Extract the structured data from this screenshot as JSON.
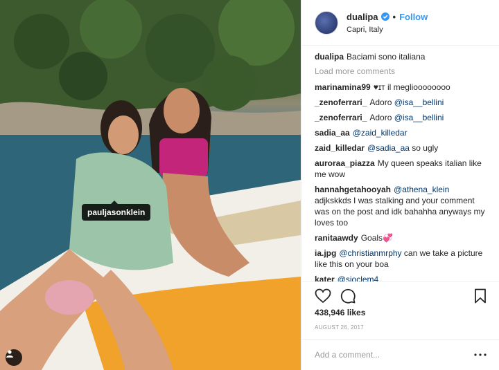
{
  "post": {
    "tag_label": "pauljasonklein",
    "icons": {
      "user_tag": "person-icon"
    }
  },
  "header": {
    "username": "dualipa",
    "verified_icon": "verified-badge-icon",
    "separator": "•",
    "follow_label": "Follow",
    "location": "Capri, Italy"
  },
  "caption": {
    "username": "dualipa",
    "text": "Baciami sono italiana"
  },
  "load_more": "Load more comments",
  "comments": [
    {
      "user": "marinamina99",
      "text": "♥ɪт il meglioooooooo"
    },
    {
      "user": "_zenoferrari_",
      "pre": "Adoro ",
      "mention": "@isa__bellini"
    },
    {
      "user": "_zenoferrari_",
      "pre": "Adoro ",
      "mention": "@isa__bellini"
    },
    {
      "user": "sadia_aa",
      "pre": "",
      "mention": "@zaid_killedar"
    },
    {
      "user": "zaid_killedar",
      "pre": "",
      "mention": "@sadia_aa",
      "post": " so ugly"
    },
    {
      "user": "auroraa_piazza",
      "text": "My queen speaks italian like me wow"
    },
    {
      "user": "hannahgetahooyah",
      "pre": "",
      "mention": "@athena_klein",
      "post": " adjkskkds I was stalking and your comment was on the post and idk bahahha anyways my loves too"
    },
    {
      "user": "ranitaawdy",
      "text": "Goals💞"
    },
    {
      "user": "ia.jpg",
      "pre": "",
      "mention": "@christianmrphy",
      "post": " can we take a picture like this on your boa"
    },
    {
      "user": "kater",
      "pre": "",
      "mention": "@sjoclem4"
    }
  ],
  "actions": {
    "like_icon": "heart-icon",
    "comment_icon": "comment-icon",
    "save_icon": "bookmark-icon"
  },
  "likes": "438,946 likes",
  "date": "AUGUST 26, 2017",
  "add_comment": {
    "placeholder": "Add a comment...",
    "more_icon": "more-options-icon"
  },
  "colors": {
    "link": "#3897f0",
    "mention": "#003569",
    "muted": "#999999"
  }
}
